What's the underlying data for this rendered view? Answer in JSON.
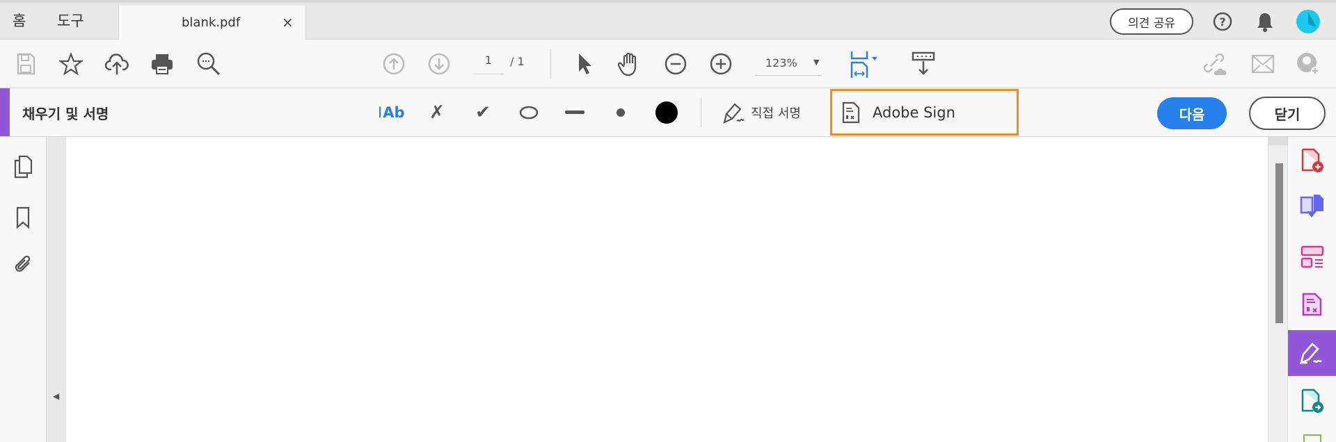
{
  "tabs": {
    "home": "홈",
    "tools": "도구",
    "document": "blank.pdf",
    "close": "×"
  },
  "header": {
    "share_label": "의견 공유"
  },
  "toolbar": {
    "page_current": "1",
    "page_total": "/ 1",
    "zoom": "123%"
  },
  "fill_sign": {
    "title": "채우기 및 서명",
    "text_tool": "Ab",
    "sign_yourself": "직접 서명",
    "adobe_sign": "Adobe Sign",
    "next": "다음",
    "close": "닫기"
  },
  "colors": {
    "accent": "#2680eb",
    "purple": "#9256d9",
    "highlight": "#f08a24"
  }
}
